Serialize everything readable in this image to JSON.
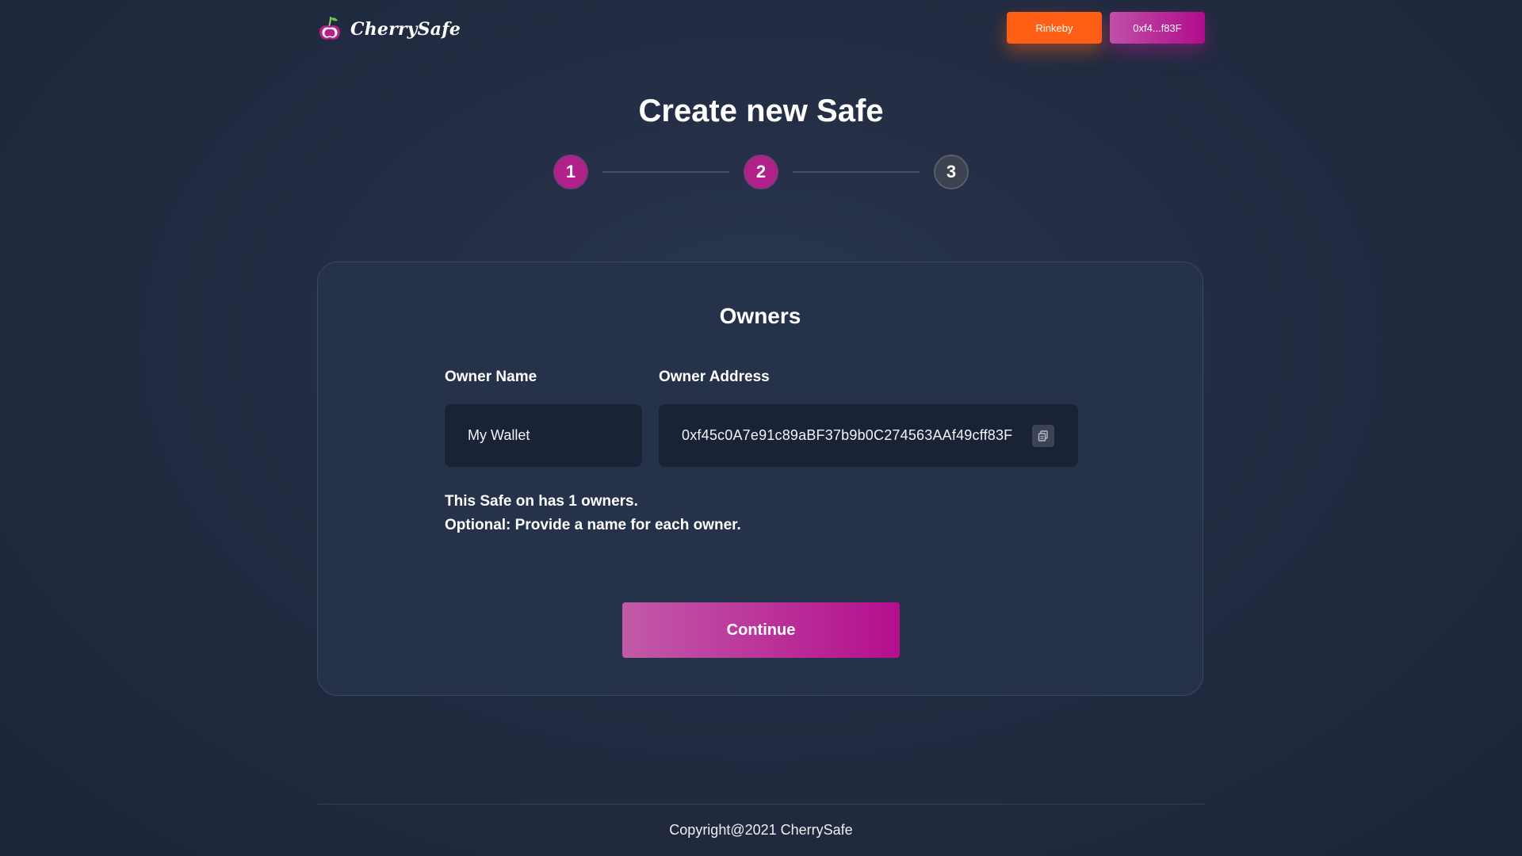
{
  "header": {
    "brand": "CherrySafe",
    "network_label": "Rinkeby",
    "wallet_label": "0xf4...f83F"
  },
  "page": {
    "title": "Create new Safe"
  },
  "stepper": {
    "steps": [
      "1",
      "2",
      "3"
    ],
    "current_step": 2
  },
  "card": {
    "title": "Owners",
    "owner_name_label": "Owner Name",
    "owner_address_label": "Owner Address",
    "owner_name_value": "My Wallet",
    "owner_address_value": "0xf45c0A7e91c89aBF37b9b0C274563AAf49cff83F",
    "info_line_1": "This Safe on has 1 owners.",
    "info_line_2": "Optional: Provide a name for each owner.",
    "continue_label": "Continue"
  },
  "footer": {
    "copyright": "Copyright@2021 CherrySafe"
  },
  "colors": {
    "background": "#222c42",
    "card": "#26314a",
    "network_button": "#ff5f15",
    "accent": "#b10c8c",
    "step_inactive": "#3d4250"
  },
  "icons": {
    "logo": "cherry-logo-icon",
    "copy": "copy-icon"
  }
}
